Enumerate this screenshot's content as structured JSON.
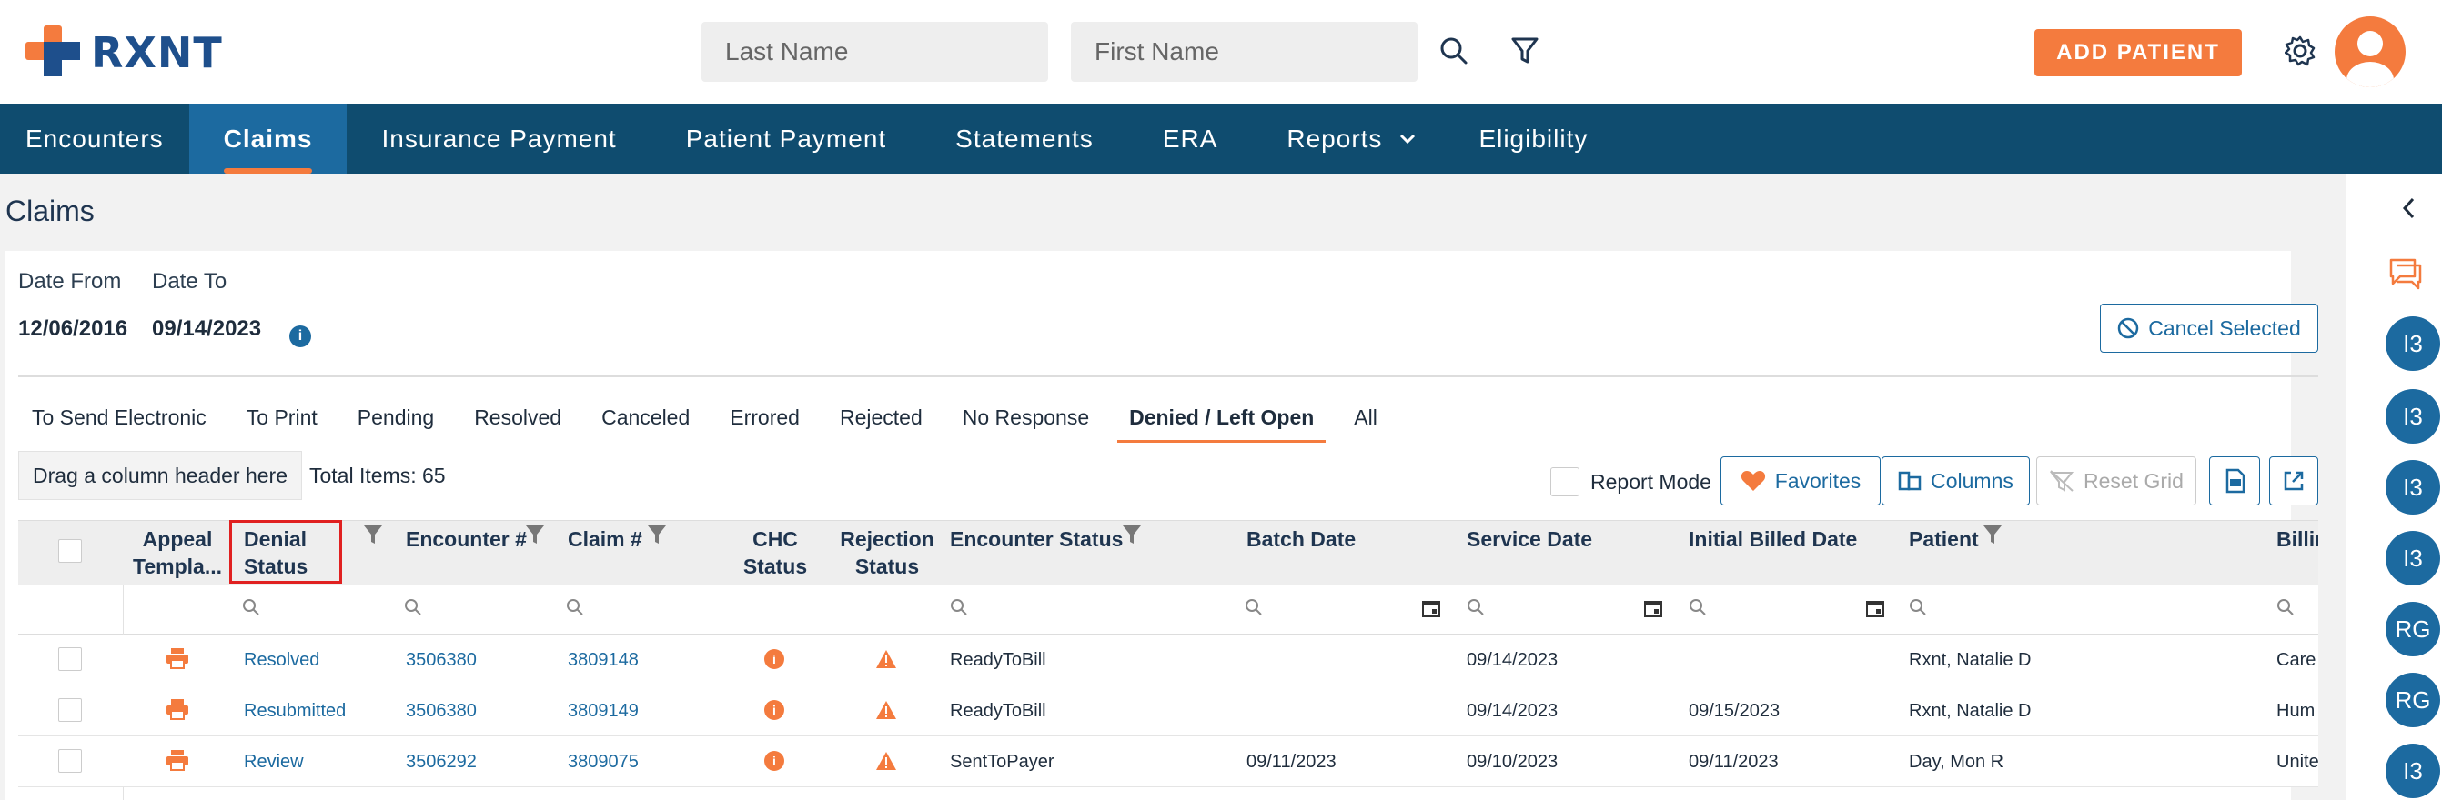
{
  "brand": {
    "name": "RXNT",
    "orange": "#f47b3e",
    "blue": "#1e4f8c",
    "nav_bg": "#0f4c6f"
  },
  "header": {
    "last_name_placeholder": "Last Name",
    "first_name_placeholder": "First Name",
    "search_icon": "search-icon",
    "filter_icon": "filter-icon",
    "add_patient": "ADD PATIENT",
    "settings_icon": "gear-icon"
  },
  "nav": {
    "items": [
      "Encounters",
      "Claims",
      "Insurance Payment",
      "Patient Payment",
      "Statements",
      "ERA",
      "Reports",
      "Eligibility"
    ],
    "active": "Claims"
  },
  "page": {
    "title": "Claims",
    "date_from_label": "Date From",
    "date_to_label": "Date To",
    "date_from": "12/06/2016",
    "date_to": "09/14/2023",
    "cancel_selected": "Cancel Selected"
  },
  "tabs": [
    "To Send Electronic",
    "To Print",
    "Pending",
    "Resolved",
    "Canceled",
    "Errored",
    "Rejected",
    "No Response",
    "Denied / Left Open",
    "All"
  ],
  "active_tab": "Denied / Left Open",
  "toolbar": {
    "drag_header": "Drag a column header here",
    "total_items": "Total Items: 65",
    "report_mode": "Report Mode",
    "favorites": "Favorites",
    "columns": "Columns",
    "reset_grid": "Reset Grid"
  },
  "grid": {
    "headers": {
      "appeal": "Appeal Templa...",
      "denial": "Denial Status",
      "encounter": "Encounter #",
      "claim": "Claim #",
      "chc": "CHC Status",
      "rejection": "Rejection Status",
      "enc_status": "Encounter Status",
      "batch": "Batch Date",
      "service": "Service Date",
      "initial": "Initial Billed Date",
      "patient": "Patient",
      "billing": "Billin"
    },
    "rows": [
      {
        "denial": "Resolved",
        "encounter": "3506380",
        "claim": "3809148",
        "enc_status": "ReadyToBill",
        "batch": "",
        "service": "09/14/2023",
        "initial": "",
        "patient": "Rxnt, Natalie D",
        "billing": "Care"
      },
      {
        "denial": "Resubmitted",
        "encounter": "3506380",
        "claim": "3809149",
        "enc_status": "ReadyToBill",
        "batch": "",
        "service": "09/14/2023",
        "initial": "09/15/2023",
        "patient": "Rxnt, Natalie D",
        "billing": "Hum"
      },
      {
        "denial": "Review",
        "encounter": "3506292",
        "claim": "3809075",
        "enc_status": "SentToPayer",
        "batch": "09/11/2023",
        "service": "09/10/2023",
        "initial": "09/11/2023",
        "patient": "Day, Mon R",
        "billing": "Unite"
      }
    ]
  },
  "sidebar": {
    "avatars": [
      "I3",
      "I3",
      "I3",
      "I3",
      "RG",
      "RG",
      "I3"
    ]
  }
}
